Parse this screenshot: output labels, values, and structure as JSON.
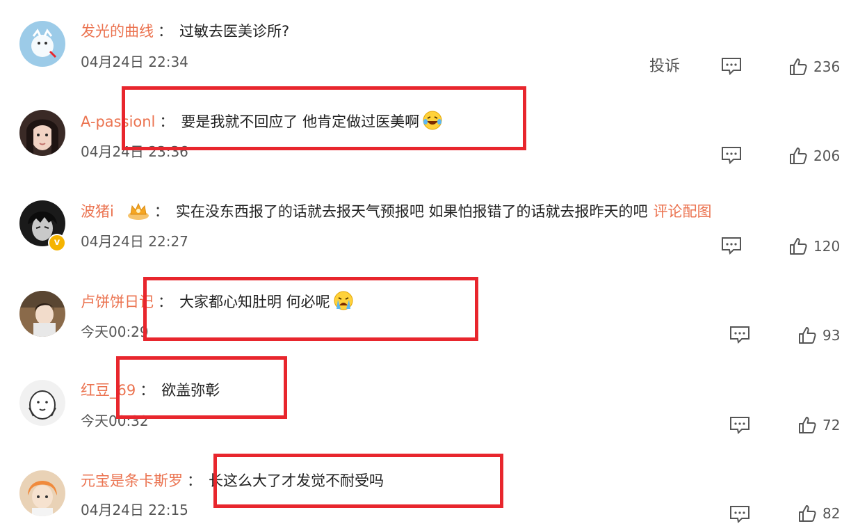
{
  "report_label": "投诉",
  "separator": "：",
  "comments": [
    {
      "user": "发光的曲线",
      "text": "过敏去医美诊所?",
      "time": "04月24日 22:34",
      "likes": "236"
    },
    {
      "user": "A-passionl",
      "text": "要是我就不回应了 他肯定做过医美啊",
      "time": "04月24日 23:36",
      "likes": "206"
    },
    {
      "user": "波猪i",
      "text": "实在没东西报了的话就去报天气预报吧 如果怕报错了的话就去报昨天的吧",
      "link": "评论配图",
      "time": "04月24日 22:27",
      "likes": "120"
    },
    {
      "user": "卢饼饼日记",
      "text": "大家都心知肚明 何必呢",
      "time": "今天00:29",
      "likes": "93"
    },
    {
      "user": "红豆_69",
      "text": "欲盖弥彰",
      "time": "今天00:32",
      "likes": "72"
    },
    {
      "user": "元宝是条卡斯罗",
      "text": "长这么大了才发觉不耐受吗",
      "time": "04月24日 22:15",
      "likes": "82"
    }
  ],
  "colors": {
    "username": "#eb7350",
    "highlight_box": "#e8262d",
    "verified": "#f5b400"
  }
}
